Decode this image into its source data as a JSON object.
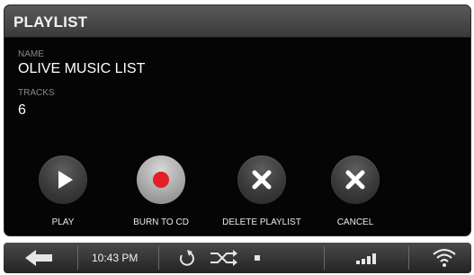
{
  "header": {
    "title": "PLAYLIST"
  },
  "details": {
    "name_label": "NAME",
    "name_value": "OLIVE MUSIC LIST",
    "tracks_label": "TRACKS",
    "tracks_value": "6"
  },
  "actions": [
    {
      "label": "PLAY",
      "icon": "play-icon"
    },
    {
      "label": "BURN TO CD",
      "icon": "record-icon"
    },
    {
      "label": "DELETE PLAYLIST",
      "icon": "close-icon"
    },
    {
      "label": "CANCEL",
      "icon": "close-icon"
    }
  ],
  "statusbar": {
    "time": "10:43 PM",
    "icons": [
      "back-arrow-icon",
      "repeat-icon",
      "shuffle-icon",
      "stop-icon",
      "signal-bars-icon",
      "wifi-icon"
    ]
  },
  "colors": {
    "record": "#e41e26",
    "header": "#4a4a4a",
    "background": "#050505"
  }
}
